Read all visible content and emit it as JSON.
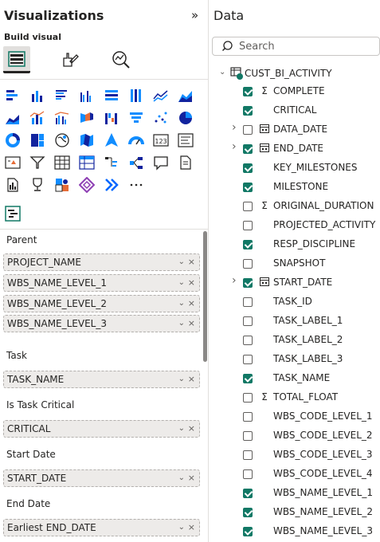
{
  "viz": {
    "title": "Visualizations",
    "collapse_glyph": "»",
    "build_label": "Build visual",
    "wells": [
      {
        "label": "Parent",
        "fields": [
          "PROJECT_NAME",
          "WBS_NAME_LEVEL_1",
          "WBS_NAME_LEVEL_2",
          "WBS_NAME_LEVEL_3"
        ]
      },
      {
        "label": "Task",
        "fields": [
          "TASK_NAME"
        ]
      },
      {
        "label": "Is Task Critical",
        "fields": [
          "CRITICAL"
        ]
      },
      {
        "label": "Start Date",
        "fields": [
          "START_DATE"
        ]
      },
      {
        "label": "End Date",
        "fields": [
          "Earliest END_DATE"
        ]
      }
    ],
    "field_remove_glyph": "×",
    "field_menu_glyph": "⌄"
  },
  "data": {
    "title": "Data",
    "search_placeholder": "Search",
    "table_name": "CUST_BI_ACTIVITY",
    "fields": [
      {
        "name": "COMPLETE",
        "checked": true,
        "icon": "sigma",
        "expandable": false
      },
      {
        "name": "CRITICAL",
        "checked": true,
        "icon": "",
        "expandable": false
      },
      {
        "name": "DATA_DATE",
        "checked": false,
        "icon": "calendar",
        "expandable": true
      },
      {
        "name": "END_DATE",
        "checked": true,
        "icon": "calendar",
        "expandable": true
      },
      {
        "name": "KEY_MILESTONES",
        "checked": true,
        "icon": "",
        "expandable": false
      },
      {
        "name": "MILESTONE",
        "checked": true,
        "icon": "",
        "expandable": false
      },
      {
        "name": "ORIGINAL_DURATION",
        "checked": false,
        "icon": "sigma",
        "expandable": false
      },
      {
        "name": "PROJECTED_ACTIVITY",
        "checked": false,
        "icon": "",
        "expandable": false
      },
      {
        "name": "RESP_DISCIPLINE",
        "checked": true,
        "icon": "",
        "expandable": false
      },
      {
        "name": "SNAPSHOT",
        "checked": false,
        "icon": "",
        "expandable": false
      },
      {
        "name": "START_DATE",
        "checked": true,
        "icon": "calendar",
        "expandable": true
      },
      {
        "name": "TASK_ID",
        "checked": false,
        "icon": "",
        "expandable": false
      },
      {
        "name": "TASK_LABEL_1",
        "checked": false,
        "icon": "",
        "expandable": false
      },
      {
        "name": "TASK_LABEL_2",
        "checked": false,
        "icon": "",
        "expandable": false
      },
      {
        "name": "TASK_LABEL_3",
        "checked": false,
        "icon": "",
        "expandable": false
      },
      {
        "name": "TASK_NAME",
        "checked": true,
        "icon": "",
        "expandable": false
      },
      {
        "name": "TOTAL_FLOAT",
        "checked": false,
        "icon": "sigma",
        "expandable": false
      },
      {
        "name": "WBS_CODE_LEVEL_1",
        "checked": false,
        "icon": "",
        "expandable": false
      },
      {
        "name": "WBS_CODE_LEVEL_2",
        "checked": false,
        "icon": "",
        "expandable": false
      },
      {
        "name": "WBS_CODE_LEVEL_3",
        "checked": false,
        "icon": "",
        "expandable": false
      },
      {
        "name": "WBS_CODE_LEVEL_4",
        "checked": false,
        "icon": "",
        "expandable": false
      },
      {
        "name": "WBS_NAME_LEVEL_1",
        "checked": true,
        "icon": "",
        "expandable": false
      },
      {
        "name": "WBS_NAME_LEVEL_2",
        "checked": true,
        "icon": "",
        "expandable": false
      },
      {
        "name": "WBS_NAME_LEVEL_3",
        "checked": true,
        "icon": "",
        "expandable": false
      }
    ]
  },
  "viz_icons": [
    "stacked-bar-chart-icon",
    "stacked-column-chart-icon",
    "clustered-bar-chart-icon",
    "clustered-column-chart-icon",
    "100-stacked-bar-chart-icon",
    "100-stacked-column-chart-icon",
    "line-chart-icon",
    "area-chart-icon",
    "stacked-area-chart-icon",
    "line-stacked-column-chart-icon",
    "line-clustered-column-chart-icon",
    "ribbon-chart-icon",
    "waterfall-chart-icon",
    "funnel-chart-icon",
    "scatter-chart-icon",
    "pie-chart-icon",
    "donut-chart-icon",
    "treemap-icon",
    "map-icon",
    "filled-map-icon",
    "azure-map-icon",
    "gauge-icon",
    "card-icon",
    "multi-row-card-icon",
    "kpi-icon",
    "slicer-icon",
    "table-icon",
    "matrix-icon",
    "decomposition-tree-icon",
    "key-influencers-icon",
    "qna-icon",
    "smart-narrative-icon",
    "paginated-report-icon",
    "trophy-icon",
    "metrics-icon",
    "power-apps-icon",
    "power-automate-icon",
    "more-visuals-icon",
    "gantt-custom-visual-icon"
  ],
  "colors": {
    "accent": "#117865",
    "chart_blue": "#118dff",
    "chart_navy": "#12239e",
    "chart_orange": "#e66c37"
  }
}
